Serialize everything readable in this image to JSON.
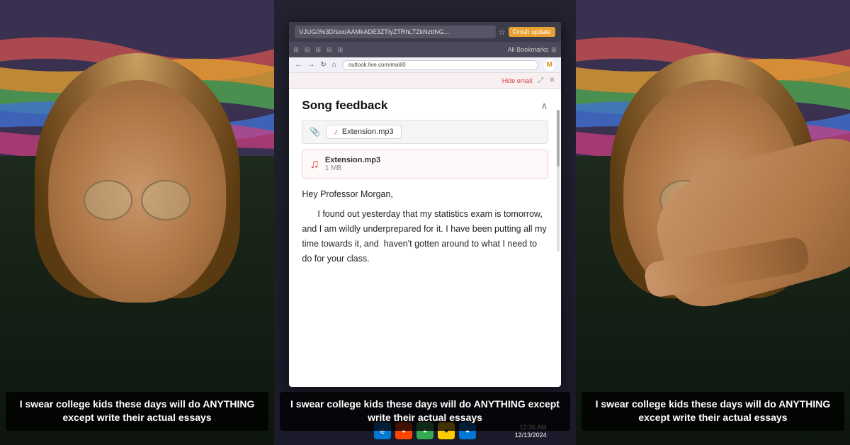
{
  "panels": {
    "left": {
      "caption": "I swear college kids these days will do ANYTHING except write their actual essays"
    },
    "center": {
      "caption": "I swear college kids these days will do ANYTHING except write their actual essays",
      "browser": {
        "url": "VJUG0%3D/sxx/AAMkADE3ZTIyZTRhLTZkNzttNG...",
        "button": "Finish update",
        "bookmarks": "All Bookmarks"
      },
      "email": {
        "hide_email": "Hide email",
        "subject": "Song feedback",
        "attachment_label": "Extension.mp3",
        "file_name": "Extension.mp3",
        "file_size": "1 MB",
        "greeting": "Hey Professor Morgan,",
        "body": "I found out yesterday that my statistics exam is tomorrow, and I am wildly underprepared for it. I have been putting all my time towards it, and  haven't gotten around to what I need to do for your class.",
        "highlight": "am wildly and !"
      },
      "taskbar": {
        "time": "12:36 AM",
        "date": "12/13/2024"
      }
    },
    "right": {
      "caption": "I swear college kids these days will do ANYTHING except write their actual essays"
    }
  }
}
